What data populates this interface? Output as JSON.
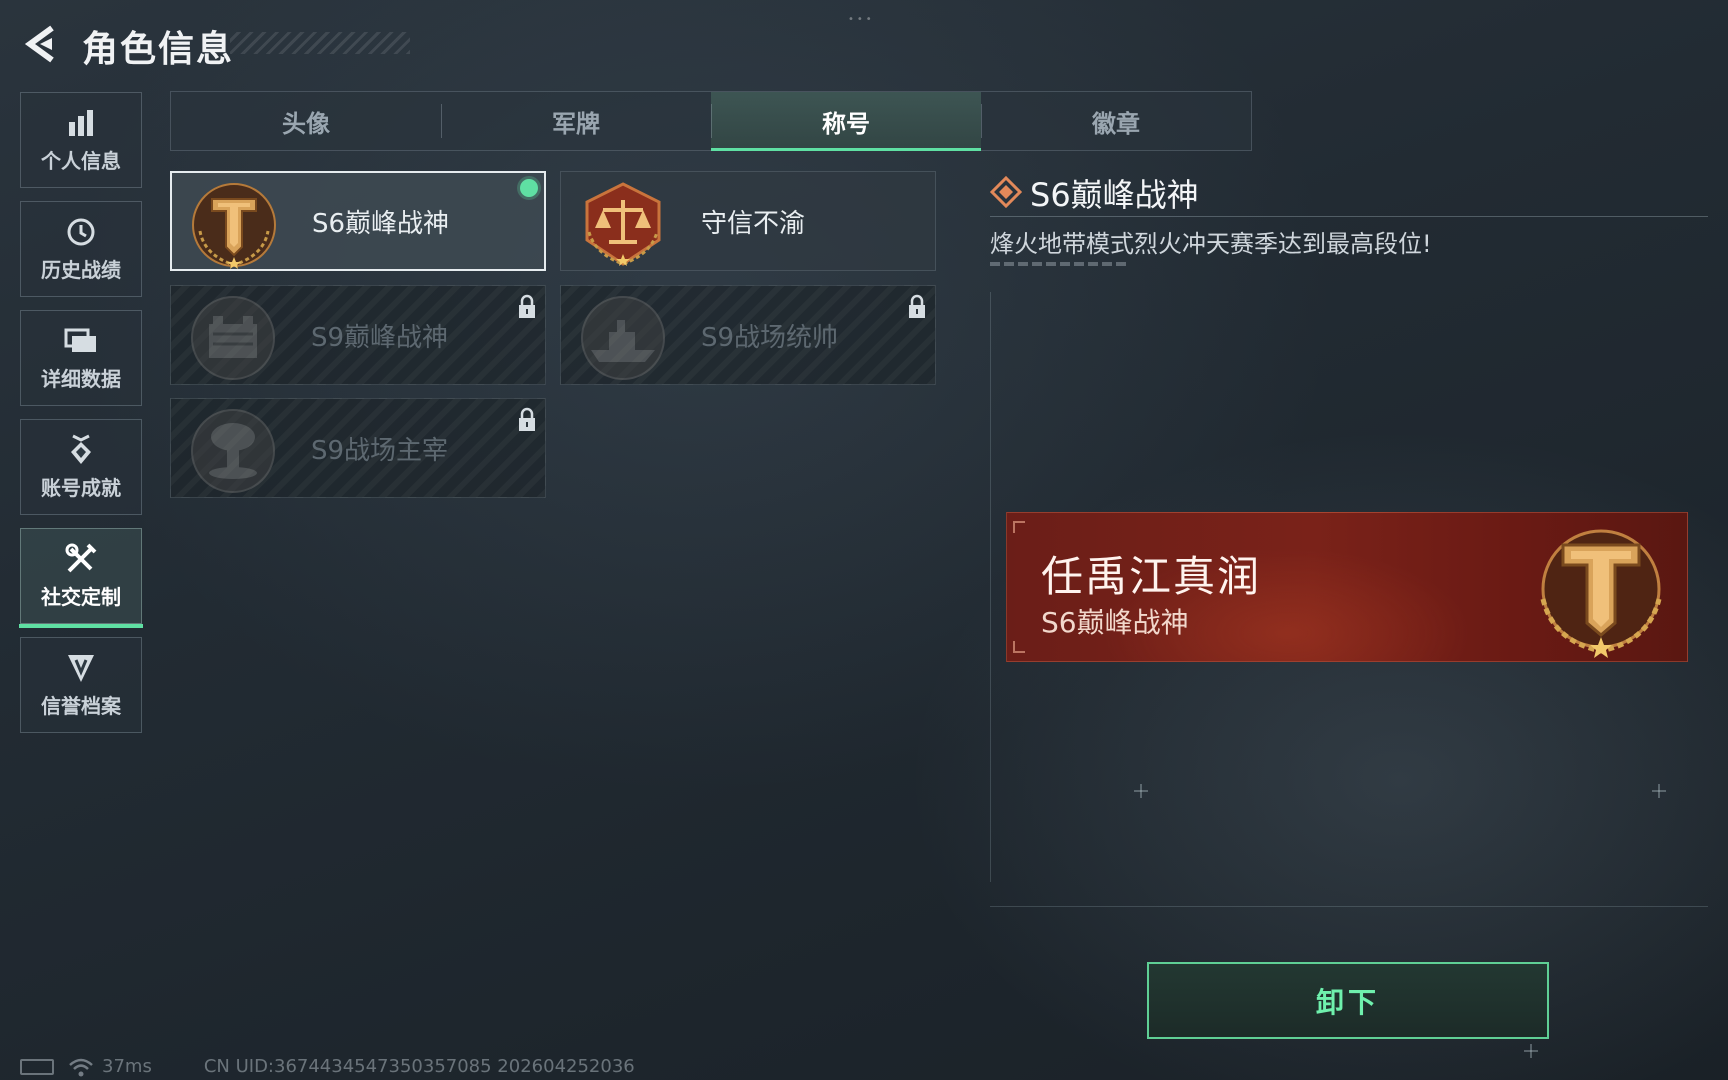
{
  "header": {
    "title": "角色信息"
  },
  "sidebar": {
    "items": [
      {
        "label": "个人信息",
        "icon": "bar-chart-icon",
        "active": false
      },
      {
        "label": "历史战绩",
        "icon": "clock-history-icon",
        "active": false
      },
      {
        "label": "详细数据",
        "icon": "folder-stack-icon",
        "active": false
      },
      {
        "label": "账号成就",
        "icon": "achievement-badge-icon",
        "active": false
      },
      {
        "label": "社交定制",
        "icon": "tools-icon",
        "active": true
      },
      {
        "label": "信誉档案",
        "icon": "credit-shield-icon",
        "active": false
      }
    ]
  },
  "tabs": [
    {
      "label": "头像",
      "active": false
    },
    {
      "label": "军牌",
      "active": false
    },
    {
      "label": "称号",
      "active": true
    },
    {
      "label": "徽章",
      "active": false
    }
  ],
  "titles": [
    {
      "name": "S6巅峰战神",
      "emblem": "peak-warrior-emblem-icon",
      "state": "equipped"
    },
    {
      "name": "守信不渝",
      "emblem": "scales-justice-emblem-icon",
      "state": "unlocked"
    },
    {
      "name": "S9巅峰战神",
      "emblem": "fortress-emblem-icon",
      "state": "locked"
    },
    {
      "name": "S9战场统帅",
      "emblem": "warship-emblem-icon",
      "state": "locked"
    },
    {
      "name": "S9战场主宰",
      "emblem": "mushroom-cloud-emblem-icon",
      "state": "locked"
    }
  ],
  "detail": {
    "title": "S6巅峰战神",
    "description": "烽火地带模式烈火冲天赛季达到最高段位!"
  },
  "nameplate": {
    "player_name": "任禹江真润",
    "title": "S6巅峰战神"
  },
  "actions": {
    "unequip_label": "卸下"
  },
  "footer": {
    "ping": "37ms",
    "uid": "CN UID:3674434547350357085 202604252036"
  },
  "colors": {
    "accent": "#5fe0a3",
    "nameplate": "#7a2219",
    "emblem_gold": "#d9a35a"
  }
}
